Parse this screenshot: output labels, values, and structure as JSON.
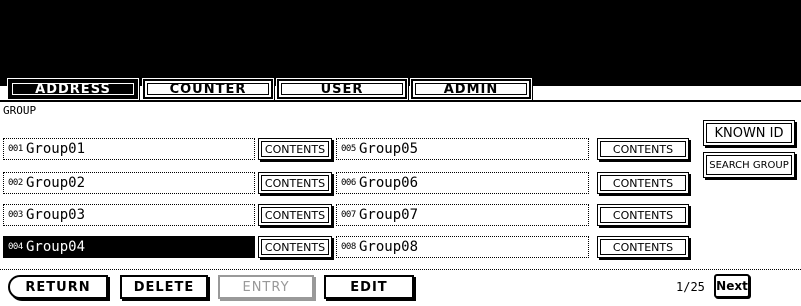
{
  "tabs": [
    {
      "label": "ADDRESS",
      "active": true
    },
    {
      "label": "COUNTER",
      "active": false
    },
    {
      "label": "USER",
      "active": false
    },
    {
      "label": "ADMIN",
      "active": false
    }
  ],
  "section_label": "GROUP",
  "groups_left": [
    {
      "num": "001",
      "name": "Group01",
      "selected": false,
      "button": "CONTENTS"
    },
    {
      "num": "002",
      "name": "Group02",
      "selected": false,
      "button": "CONTENTS"
    },
    {
      "num": "003",
      "name": "Group03",
      "selected": false,
      "button": "CONTENTS"
    },
    {
      "num": "004",
      "name": "Group04",
      "selected": true,
      "button": "CONTENTS"
    }
  ],
  "groups_right": [
    {
      "num": "005",
      "name": "Group05",
      "selected": false,
      "button": "CONTENTS"
    },
    {
      "num": "006",
      "name": "Group06",
      "selected": false,
      "button": "CONTENTS"
    },
    {
      "num": "007",
      "name": "Group07",
      "selected": false,
      "button": "CONTENTS"
    },
    {
      "num": "008",
      "name": "Group08",
      "selected": false,
      "button": "CONTENTS"
    }
  ],
  "side_buttons": {
    "known_id": "KNOWN ID",
    "search_group": "SEARCH GROUP"
  },
  "bottom": {
    "return": "RETURN",
    "delete": "DELETE",
    "entry": "ENTRY",
    "edit": "EDIT"
  },
  "pagination": {
    "indicator": "1/25",
    "next": "Next"
  }
}
